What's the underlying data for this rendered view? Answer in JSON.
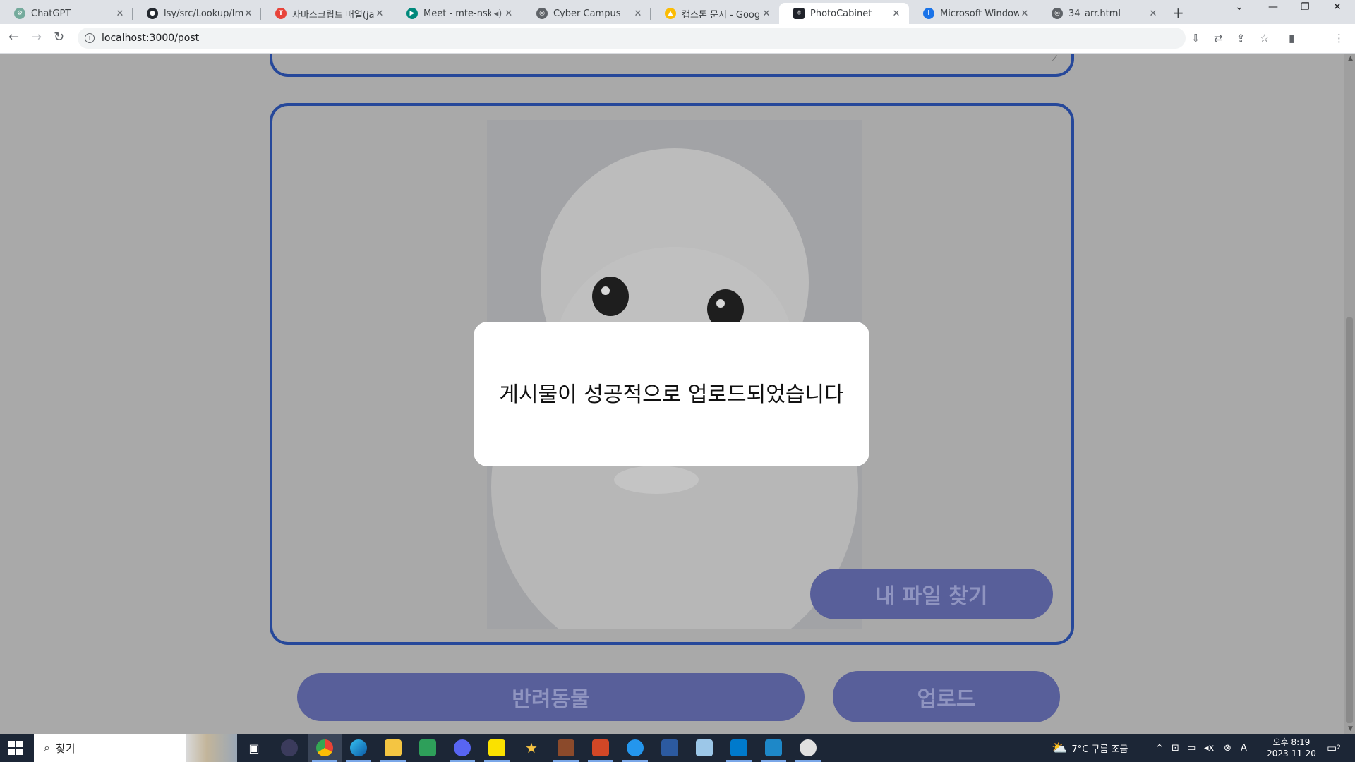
{
  "browser": {
    "tabs": [
      {
        "title": "ChatGPT",
        "favicon_color": "#74aa9c",
        "active": false
      },
      {
        "title": "lsy/src/Lookup/Image",
        "favicon_color": "#24292f",
        "active": false
      },
      {
        "title": "자바스크립트 배열(ja",
        "favicon_color": "#e8443a",
        "active": false
      },
      {
        "title": "Meet - mte-nsko",
        "favicon_color": "#00897b",
        "active": false
      },
      {
        "title": "Cyber Campus",
        "favicon_color": "#5f6368",
        "active": false
      },
      {
        "title": "캡스톤 문서 - Googl",
        "favicon_color": "#fbbc04",
        "active": false
      },
      {
        "title": "PhotoCabinet",
        "favicon_color": "#20232a",
        "active": true
      },
      {
        "title": "Microsoft Windows",
        "favicon_color": "#1a73e8",
        "active": false
      },
      {
        "title": "34_arr.html",
        "favicon_color": "#5f6368",
        "active": false
      }
    ],
    "new_tab_label": "+",
    "url": "localhost:3000/post"
  },
  "page": {
    "modal_message": "게시물이 성공적으로 업로드되었습니다",
    "file_button_label": "내 파일 찾기",
    "category_button_label": "반려동물",
    "upload_button_label": "업로드",
    "accent_color": "#26489a",
    "button_color": "#585f9a"
  },
  "taskbar": {
    "search_placeholder": "찾기",
    "weather": "7°C  구름 조금",
    "ime_label": "A",
    "time": "오후 8:19",
    "date": "2023-11-20",
    "notification_count": "2"
  }
}
